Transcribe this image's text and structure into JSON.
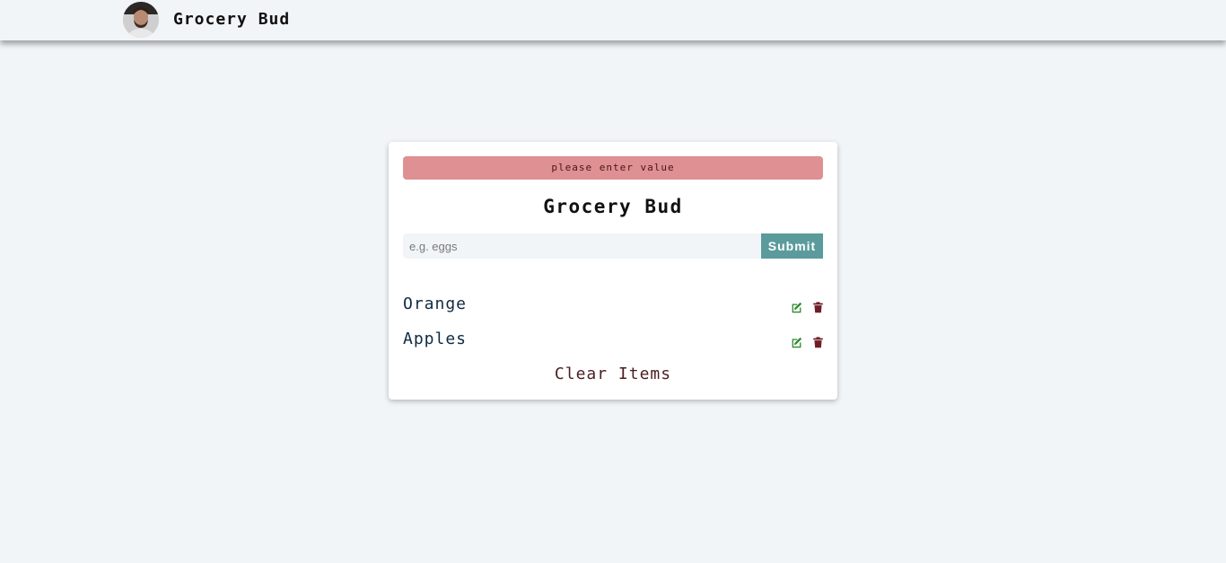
{
  "navbar": {
    "title": "Grocery Bud"
  },
  "alert": {
    "message": "please enter value",
    "color": "#df9093"
  },
  "card": {
    "title": "Grocery Bud"
  },
  "form": {
    "placeholder": "e.g. eggs",
    "value": "",
    "submit_label": "Submit"
  },
  "items": [
    {
      "label": "Orange"
    },
    {
      "label": "Apples"
    }
  ],
  "clear_label": "Clear Items",
  "colors": {
    "accent": "#5b9b9c",
    "edit_icon": "#2c8a2c",
    "delete_icon": "#6e1e26",
    "background": "#f1f5f8"
  },
  "icons": {
    "edit": "edit-icon",
    "delete": "trash-icon"
  }
}
